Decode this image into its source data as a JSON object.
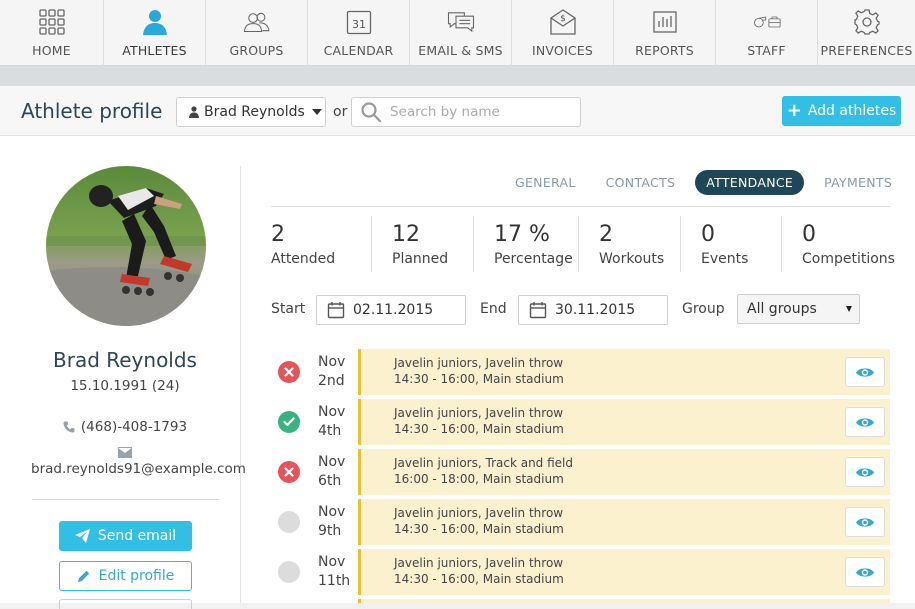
{
  "nav": {
    "items": [
      {
        "label": "HOME",
        "icon": "grid-icon"
      },
      {
        "label": "ATHLETES",
        "icon": "person-icon"
      },
      {
        "label": "GROUPS",
        "icon": "people-icon"
      },
      {
        "label": "CALENDAR",
        "icon": "calendar-icon",
        "icon_text": "31"
      },
      {
        "label": "EMAIL & SMS",
        "icon": "chat-icon"
      },
      {
        "label": "INVOICES",
        "icon": "invoice-icon"
      },
      {
        "label": "REPORTS",
        "icon": "chart-icon"
      },
      {
        "label": "STAFF",
        "icon": "whistle-icon"
      },
      {
        "label": "PREFERENCES",
        "icon": "gear-icon"
      }
    ],
    "active": "ATHLETES",
    "active_color": "#2aa8d8"
  },
  "header": {
    "title": "Athlete profile",
    "athlete_selected": "Brad Reynolds",
    "or_text": "or",
    "search_placeholder": "Search by name",
    "add_button": "Add athletes"
  },
  "profile": {
    "name": "Brad Reynolds",
    "dob": "15.10.1991 (24)",
    "phone": "(468)-408-1793",
    "email": "brad.reynolds91@example.com",
    "send_email": "Send email",
    "edit_profile": "Edit profile"
  },
  "tabs": [
    {
      "label": "GENERAL",
      "active": false
    },
    {
      "label": "CONTACTS",
      "active": false
    },
    {
      "label": "ATTENDANCE",
      "active": true
    },
    {
      "label": "PAYMENTS",
      "active": false
    }
  ],
  "stats": [
    {
      "value": "2",
      "label": "Attended"
    },
    {
      "value": "12",
      "label": "Planned"
    },
    {
      "value": "17 %",
      "label": "Percentage"
    },
    {
      "value": "2",
      "label": "Workouts"
    },
    {
      "value": "0",
      "label": "Events"
    },
    {
      "value": "0",
      "label": "Competitions"
    }
  ],
  "filter": {
    "start_label": "Start",
    "start_value": "02.11.2015",
    "end_label": "End",
    "end_value": "30.11.2015",
    "group_label": "Group",
    "group_value": "All groups"
  },
  "attendance": [
    {
      "status": "absent",
      "month": "Nov",
      "day": "2nd",
      "title": "Javelin juniors, Javelin throw",
      "detail": "14:30 - 16:00, Main stadium"
    },
    {
      "status": "present",
      "month": "Nov",
      "day": "4th",
      "title": "Javelin juniors, Javelin throw",
      "detail": "14:30 - 16:00, Main stadium"
    },
    {
      "status": "absent",
      "month": "Nov",
      "day": "6th",
      "title": "Javelin juniors, Track and field",
      "detail": "16:00 - 18:00, Main stadium"
    },
    {
      "status": "none",
      "month": "Nov",
      "day": "9th",
      "title": "Javelin juniors, Javelin throw",
      "detail": "14:30 - 16:00, Main stadium"
    },
    {
      "status": "none",
      "month": "Nov",
      "day": "11th",
      "title": "Javelin juniors, Javelin throw",
      "detail": "14:30 - 16:00, Main stadium"
    }
  ],
  "colors": {
    "accent": "#33bfe3",
    "absent": "#e5535b",
    "present": "#36b37e",
    "unmarked": "#dcdcdc",
    "card": "#fcf1cf",
    "card_border": "#e8c233"
  }
}
